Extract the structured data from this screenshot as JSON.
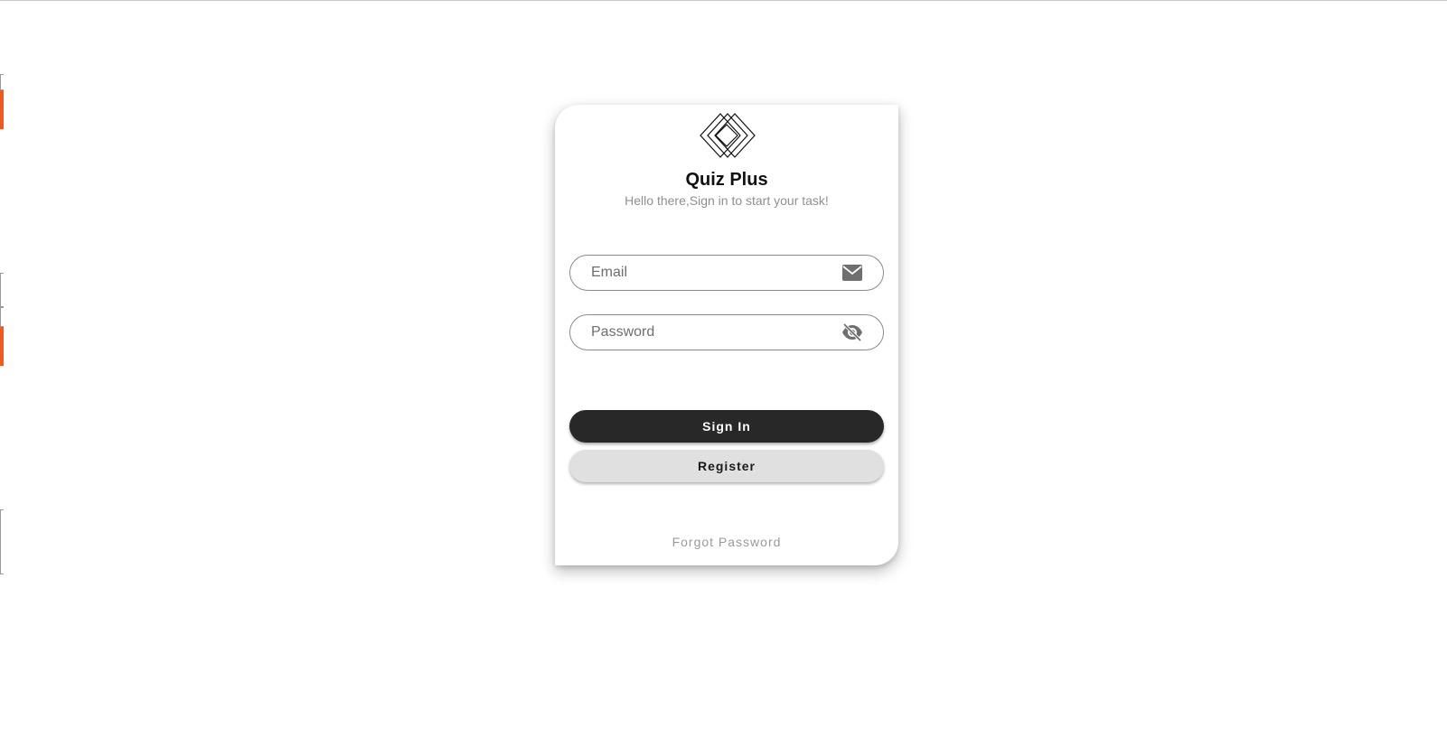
{
  "app": {
    "title": "Quiz Plus",
    "subtitle": "Hello there,Sign in to start your task!"
  },
  "form": {
    "email": {
      "placeholder": "Email",
      "value": "",
      "icon": "mail-icon"
    },
    "password": {
      "placeholder": "Password",
      "value": "",
      "icon": "eye-off-icon"
    }
  },
  "buttons": {
    "sign_in_label": "Sign In",
    "register_label": "Register",
    "forgot_password_label": "Forgot Password"
  },
  "logo": {
    "icon": "stacked-diamonds-logo"
  },
  "colors": {
    "primary_button": "#282828",
    "secondary_button": "#e0e0e0",
    "muted_text": "#9a9a9a",
    "edge_accent": "#f05a1e"
  }
}
